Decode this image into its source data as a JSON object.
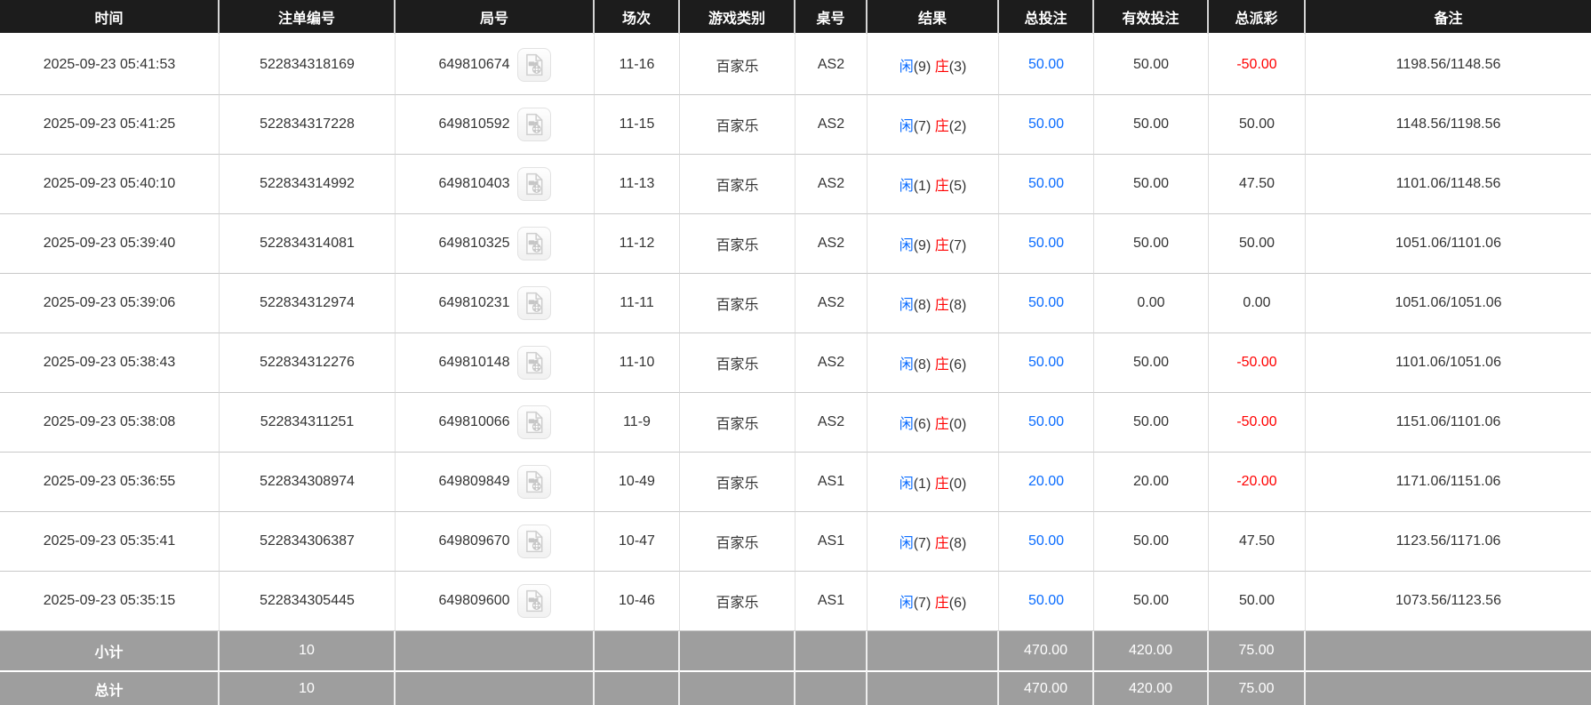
{
  "colors": {
    "header_bg": "#1c1c1c",
    "accent_blue": "#0a6cff",
    "negative_red": "#ff0000",
    "summary_bg": "#9e9e9e",
    "row_border": "#c9c9c9"
  },
  "icons": {
    "round_replay": "video-replay-icon"
  },
  "table": {
    "columns": [
      {
        "key": "time",
        "label": "时间"
      },
      {
        "key": "bet_no",
        "label": "注单编号"
      },
      {
        "key": "round_no",
        "label": "局号"
      },
      {
        "key": "session",
        "label": "场次"
      },
      {
        "key": "game_type",
        "label": "游戏类别"
      },
      {
        "key": "table_no",
        "label": "桌号"
      },
      {
        "key": "result",
        "label": "结果"
      },
      {
        "key": "total_bet",
        "label": "总投注"
      },
      {
        "key": "valid_bet",
        "label": "有效投注"
      },
      {
        "key": "total_payout",
        "label": "总派彩"
      },
      {
        "key": "remark",
        "label": "备注"
      }
    ],
    "result_labels": {
      "player": "闲",
      "banker": "庄"
    },
    "rows": [
      {
        "time": "2025-09-23 05:41:53",
        "bet_no": "522834318169",
        "round_no": "649810674",
        "session": "11-16",
        "game_type": "百家乐",
        "table_no": "AS2",
        "player": "9",
        "banker": "3",
        "total_bet": "50.00",
        "valid_bet": "50.00",
        "total_payout": "-50.00",
        "remark": "1198.56/1148.56"
      },
      {
        "time": "2025-09-23 05:41:25",
        "bet_no": "522834317228",
        "round_no": "649810592",
        "session": "11-15",
        "game_type": "百家乐",
        "table_no": "AS2",
        "player": "7",
        "banker": "2",
        "total_bet": "50.00",
        "valid_bet": "50.00",
        "total_payout": "50.00",
        "remark": "1148.56/1198.56"
      },
      {
        "time": "2025-09-23 05:40:10",
        "bet_no": "522834314992",
        "round_no": "649810403",
        "session": "11-13",
        "game_type": "百家乐",
        "table_no": "AS2",
        "player": "1",
        "banker": "5",
        "total_bet": "50.00",
        "valid_bet": "50.00",
        "total_payout": "47.50",
        "remark": "1101.06/1148.56"
      },
      {
        "time": "2025-09-23 05:39:40",
        "bet_no": "522834314081",
        "round_no": "649810325",
        "session": "11-12",
        "game_type": "百家乐",
        "table_no": "AS2",
        "player": "9",
        "banker": "7",
        "total_bet": "50.00",
        "valid_bet": "50.00",
        "total_payout": "50.00",
        "remark": "1051.06/1101.06"
      },
      {
        "time": "2025-09-23 05:39:06",
        "bet_no": "522834312974",
        "round_no": "649810231",
        "session": "11-11",
        "game_type": "百家乐",
        "table_no": "AS2",
        "player": "8",
        "banker": "8",
        "total_bet": "50.00",
        "valid_bet": "0.00",
        "total_payout": "0.00",
        "remark": "1051.06/1051.06"
      },
      {
        "time": "2025-09-23 05:38:43",
        "bet_no": "522834312276",
        "round_no": "649810148",
        "session": "11-10",
        "game_type": "百家乐",
        "table_no": "AS2",
        "player": "8",
        "banker": "6",
        "total_bet": "50.00",
        "valid_bet": "50.00",
        "total_payout": "-50.00",
        "remark": "1101.06/1051.06"
      },
      {
        "time": "2025-09-23 05:38:08",
        "bet_no": "522834311251",
        "round_no": "649810066",
        "session": "11-9",
        "game_type": "百家乐",
        "table_no": "AS2",
        "player": "6",
        "banker": "0",
        "total_bet": "50.00",
        "valid_bet": "50.00",
        "total_payout": "-50.00",
        "remark": "1151.06/1101.06"
      },
      {
        "time": "2025-09-23 05:36:55",
        "bet_no": "522834308974",
        "round_no": "649809849",
        "session": "10-49",
        "game_type": "百家乐",
        "table_no": "AS1",
        "player": "1",
        "banker": "0",
        "total_bet": "20.00",
        "valid_bet": "20.00",
        "total_payout": "-20.00",
        "remark": "1171.06/1151.06"
      },
      {
        "time": "2025-09-23 05:35:41",
        "bet_no": "522834306387",
        "round_no": "649809670",
        "session": "10-47",
        "game_type": "百家乐",
        "table_no": "AS1",
        "player": "7",
        "banker": "8",
        "total_bet": "50.00",
        "valid_bet": "50.00",
        "total_payout": "47.50",
        "remark": "1123.56/1171.06"
      },
      {
        "time": "2025-09-23 05:35:15",
        "bet_no": "522834305445",
        "round_no": "649809600",
        "session": "10-46",
        "game_type": "百家乐",
        "table_no": "AS1",
        "player": "7",
        "banker": "6",
        "total_bet": "50.00",
        "valid_bet": "50.00",
        "total_payout": "50.00",
        "remark": "1073.56/1123.56"
      }
    ],
    "subtotal": {
      "label": "小计",
      "count": "10",
      "total_bet": "470.00",
      "valid_bet": "420.00",
      "total_payout": "75.00"
    },
    "grand_total": {
      "label": "总计",
      "count": "10",
      "total_bet": "470.00",
      "valid_bet": "420.00",
      "total_payout": "75.00"
    }
  }
}
